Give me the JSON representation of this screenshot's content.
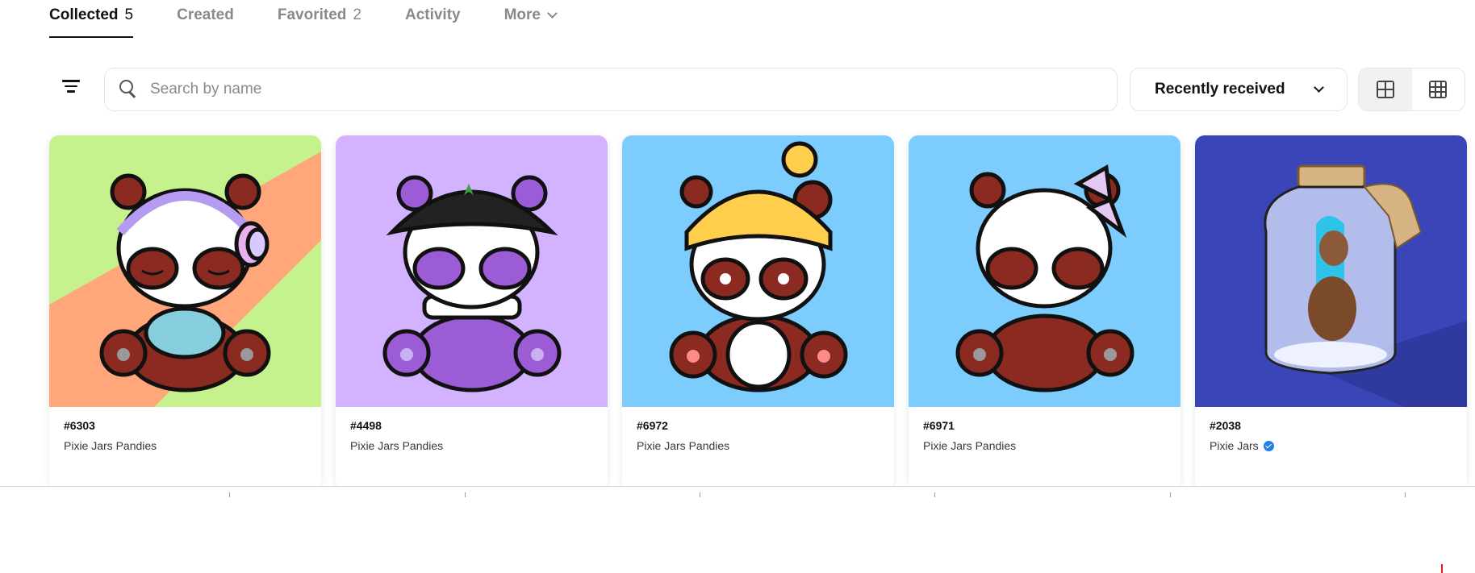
{
  "tabs": [
    {
      "label": "Collected",
      "count": "5",
      "active": true
    },
    {
      "label": "Created",
      "count": "",
      "active": false
    },
    {
      "label": "Favorited",
      "count": "2",
      "active": false
    },
    {
      "label": "Activity",
      "count": "",
      "active": false
    },
    {
      "label": "More",
      "count": "",
      "active": false
    }
  ],
  "toolbar": {
    "filter_icon": "filter-icon",
    "search_placeholder": "Search by name",
    "search_value": "",
    "sort_label": "Recently received",
    "view_modes": [
      "large-grid-icon",
      "small-grid-icon"
    ],
    "active_view": "large-grid"
  },
  "items": [
    {
      "token": "#6303",
      "collection": "Pixie Jars Pandies",
      "verified": false,
      "bg": "#c5f28c",
      "accent": "#ffa77a"
    },
    {
      "token": "#4498",
      "collection": "Pixie Jars Pandies",
      "verified": false,
      "bg": "#d3b2ff",
      "accent": "#9b5cd6"
    },
    {
      "token": "#6972",
      "collection": "Pixie Jars Pandies",
      "verified": false,
      "bg": "#7ccdfd",
      "accent": "#ffce4d"
    },
    {
      "token": "#6971",
      "collection": "Pixie Jars Pandies",
      "verified": false,
      "bg": "#7ccdfd",
      "accent": "#e6c8f4"
    },
    {
      "token": "#2038",
      "collection": "Pixie Jars",
      "verified": true,
      "bg": "#3a45b8",
      "accent": "#c9d2f5"
    }
  ],
  "colors": {
    "text": "#121212",
    "muted": "#8a8a8a",
    "border": "#e5e5e5",
    "verified": "#2081e2",
    "panda_brown": "#8a2a20"
  }
}
